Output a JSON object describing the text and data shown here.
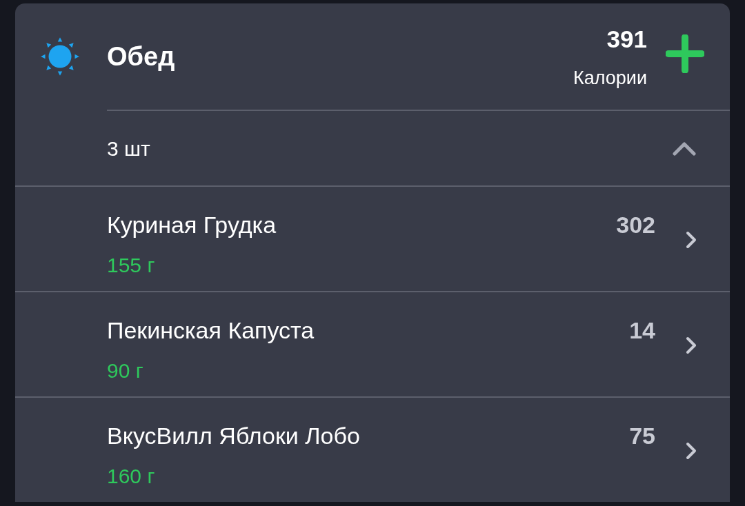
{
  "meal": {
    "title": "Обед",
    "calories": "391",
    "calories_label": "Калории"
  },
  "summary": {
    "count": "3 шт",
    "expanded": true
  },
  "items": [
    {
      "name": "Куриная Грудка",
      "weight": "155 г",
      "calories": "302"
    },
    {
      "name": "Пекинская Капуста",
      "weight": "90 г",
      "calories": "14"
    },
    {
      "name": "ВкусВилл Яблоки Лобо",
      "weight": "160 г",
      "calories": "75"
    }
  ]
}
